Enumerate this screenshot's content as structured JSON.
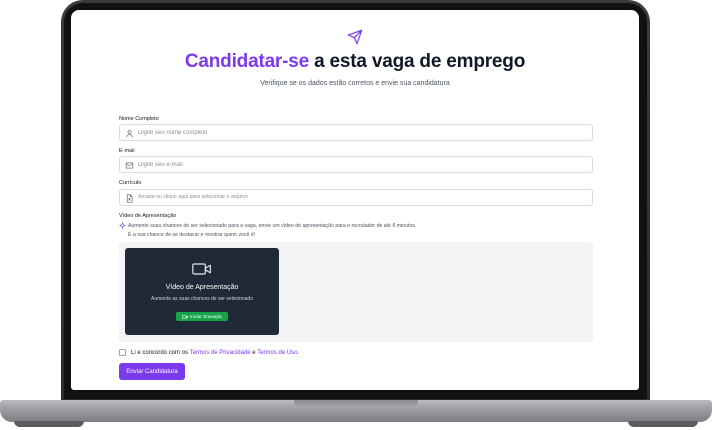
{
  "header": {
    "title_accent": "Candidatar-se",
    "title_rest": " a esta vaga de emprego",
    "subtitle": "Verifique se os dados estão corretos e envie sua candidatura"
  },
  "form": {
    "name": {
      "label": "Nome Completo",
      "placeholder": "Digite seu nome completo",
      "value": "",
      "icon": "user-icon"
    },
    "email": {
      "label": "E-mail",
      "placeholder": "Digite seu e-mail",
      "value": "",
      "icon": "mail-icon"
    },
    "resume": {
      "label": "Currículo",
      "placeholder": "Arraste ou clique aqui para selecionar o arquivo",
      "icon": "file-upload-icon"
    },
    "video": {
      "label": "Vídeo de Apresentação",
      "hint_line1": "Aumente suas chances de ser selecionado para a vaga, envie um vídeo de apresentação para o recrutador de até 6 minutos.",
      "hint_line2": "É a sua chance de se destacar e mostrar quem você é!",
      "card_title": "Vídeo de Apresentação",
      "card_subtitle": "Aumente as suas chances de ser selecionado",
      "record_label": "Iniciar Gravação",
      "record_color": "#16a34a"
    },
    "terms": {
      "prefix": "Li e concordo com os ",
      "privacy_link": "Termos de Privacidade",
      "conjunction": " e ",
      "use_link": "Termos de Uso.",
      "checked": false
    },
    "submit_label": "Enviar Candidatura"
  },
  "colors": {
    "accent": "#7c3aed",
    "dark_card": "#1f2937",
    "success": "#16a34a"
  }
}
